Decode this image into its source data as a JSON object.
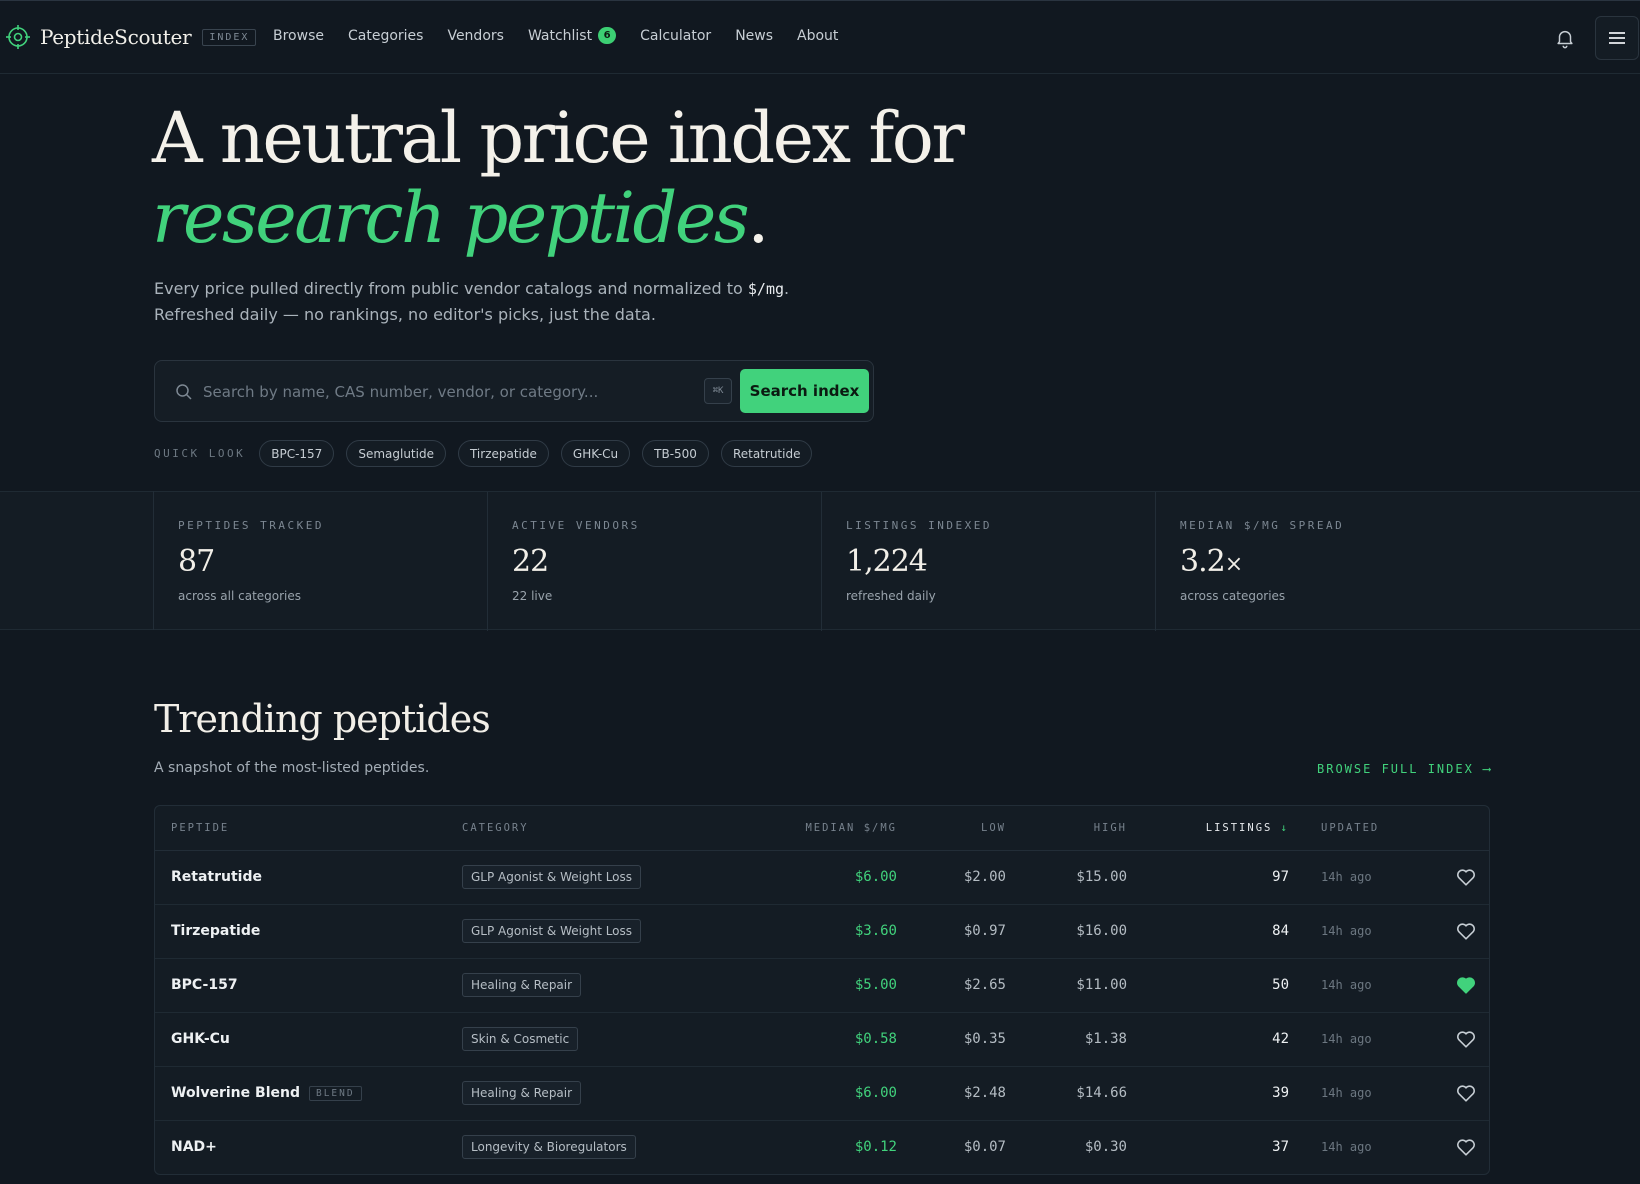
{
  "brand": {
    "name": "PeptideScouter",
    "tag": "INDEX"
  },
  "nav": {
    "links": [
      "Browse",
      "Categories",
      "Vendors",
      "Watchlist",
      "Calculator",
      "News",
      "About"
    ],
    "watchlist_count": "6"
  },
  "hero": {
    "title_line1": "A neutral price index for",
    "title_accent": "research peptides",
    "title_dot": ".",
    "sub_part1": "Every price pulled directly from public vendor catalogs and normalized to ",
    "sub_code": "$/mg",
    "sub_part2": ".",
    "sub_line2": "Refreshed daily — no rankings, no editor's picks, just the data."
  },
  "search": {
    "placeholder": "Search by name, CAS number, vendor, or category...",
    "shortcut": "⌘K",
    "button": "Search index"
  },
  "quick_look": {
    "label": "QUICK LOOK",
    "chips": [
      "BPC-157",
      "Semaglutide",
      "Tirzepatide",
      "GHK-Cu",
      "TB-500",
      "Retatrutide"
    ]
  },
  "stats": [
    {
      "label": "PEPTIDES TRACKED",
      "value": "87",
      "suffix": "",
      "sub": "across all categories"
    },
    {
      "label": "ACTIVE VENDORS",
      "value": "22",
      "suffix": "",
      "sub": "22 live"
    },
    {
      "label": "LISTINGS INDEXED",
      "value": "1,224",
      "suffix": "",
      "sub": "refreshed daily"
    },
    {
      "label": "MEDIAN $/MG SPREAD",
      "value": "3.2",
      "suffix": "×",
      "sub": "across categories"
    }
  ],
  "trending": {
    "title": "Trending peptides",
    "subtitle": "A snapshot of the most-listed peptides.",
    "browse_label": "BROWSE FULL INDEX ⟶",
    "columns": {
      "peptide": "PEPTIDE",
      "category": "CATEGORY",
      "median": "MEDIAN $/MG",
      "low": "LOW",
      "high": "HIGH",
      "listings": "LISTINGS",
      "listings_arrow": "↓",
      "updated": "UPDATED"
    },
    "rows": [
      {
        "name": "Retatrutide",
        "blend": "",
        "category": "GLP Agonist & Weight Loss",
        "median": "$6.00",
        "low": "$2.00",
        "high": "$15.00",
        "listings": "97",
        "updated": "14h ago",
        "favorited": false
      },
      {
        "name": "Tirzepatide",
        "blend": "",
        "category": "GLP Agonist & Weight Loss",
        "median": "$3.60",
        "low": "$0.97",
        "high": "$16.00",
        "listings": "84",
        "updated": "14h ago",
        "favorited": false
      },
      {
        "name": "BPC-157",
        "blend": "",
        "category": "Healing & Repair",
        "median": "$5.00",
        "low": "$2.65",
        "high": "$11.00",
        "listings": "50",
        "updated": "14h ago",
        "favorited": true
      },
      {
        "name": "GHK-Cu",
        "blend": "",
        "category": "Skin & Cosmetic",
        "median": "$0.58",
        "low": "$0.35",
        "high": "$1.38",
        "listings": "42",
        "updated": "14h ago",
        "favorited": false
      },
      {
        "name": "Wolverine Blend",
        "blend": "BLEND",
        "category": "Healing & Repair",
        "median": "$6.00",
        "low": "$2.48",
        "high": "$14.66",
        "listings": "39",
        "updated": "14h ago",
        "favorited": false
      },
      {
        "name": "NAD+",
        "blend": "",
        "category": "Longevity & Bioregulators",
        "median": "$0.12",
        "low": "$0.07",
        "high": "$0.30",
        "listings": "37",
        "updated": "14h ago",
        "favorited": false
      }
    ]
  },
  "colors": {
    "accent": "#41d27c",
    "background": "#111820",
    "panel": "#141c24"
  },
  "icons": {
    "logo": "crosshair-logo-icon",
    "bell": "bell-icon",
    "menu": "menu-icon",
    "search": "search-icon",
    "favorite": "heart-icon"
  }
}
